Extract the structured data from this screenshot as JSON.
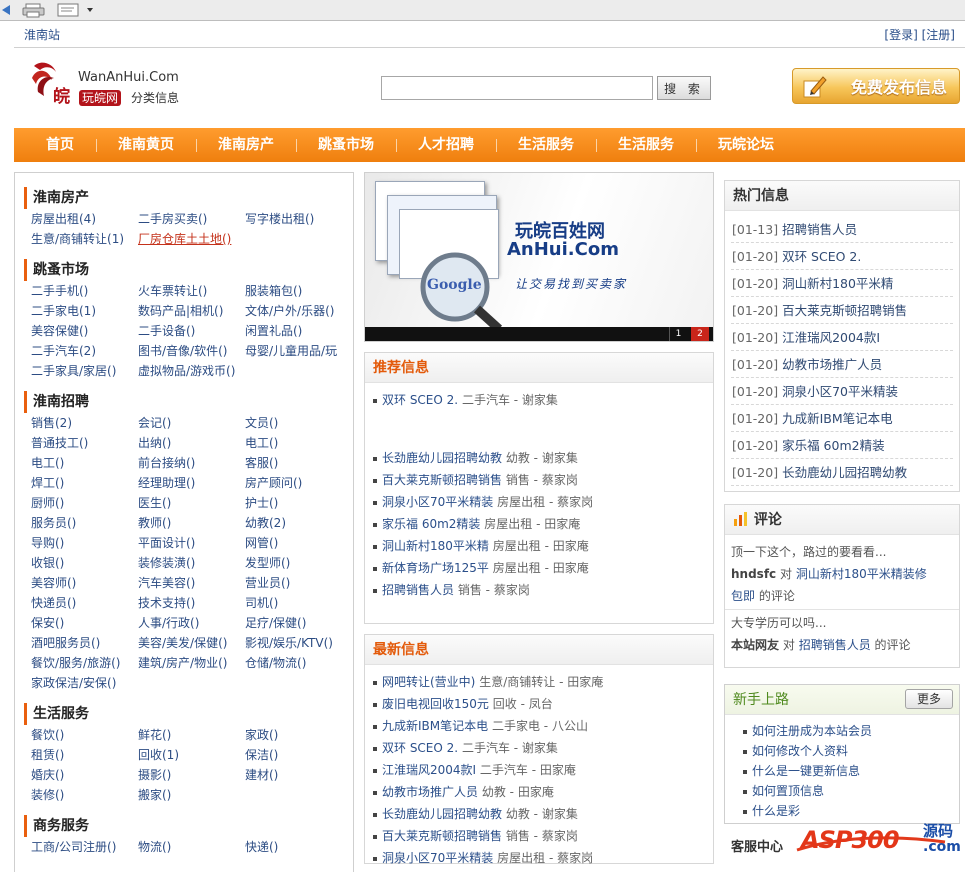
{
  "header": {
    "city": "淮南站",
    "login": "[登录]",
    "register": "[注册]",
    "logo_en": "WanAnHui.Com",
    "logo_cn_badge": "玩皖网",
    "logo_cn_text": "分类信息",
    "logo_glyph": "皖",
    "search_button": "搜 索",
    "search_value": "",
    "post_button": "免费发布信息"
  },
  "nav": [
    "首页",
    "淮南黄页",
    "淮南房产",
    "跳蚤市场",
    "人才招聘",
    "生活服务",
    "生活服务",
    "玩皖论坛"
  ],
  "categories": [
    {
      "title": "淮南房产",
      "items": [
        "房屋出租(4)",
        "二手房买卖()",
        "写字楼出租()",
        "生意/商铺转让(1)",
        "厂房仓库土土地()"
      ],
      "hot_index": 4
    },
    {
      "title": "跳蚤市场",
      "items": [
        "二手手机()",
        "火车票转让()",
        "服装箱包()",
        "二手家电(1)",
        "数码产品|相机()",
        "文体/户外/乐器()",
        "美容保健()",
        "二手设备()",
        "闲置礼品()",
        "二手汽车(2)",
        "图书/音像/软件()",
        "母婴/儿童用品/玩",
        "二手家具/家居()",
        "虚拟物品/游戏币()"
      ]
    },
    {
      "title": "淮南招聘",
      "items": [
        "销售(2)",
        "会记()",
        "文员()",
        "普通技工()",
        "出纳()",
        "电工()",
        "电工()",
        "前台接纳()",
        "客服()",
        "焊工()",
        "经理助理()",
        "房产顾问()",
        "厨师()",
        "医生()",
        "护士()",
        "服务员()",
        "教师()",
        "幼教(2)",
        "导购()",
        "平面设计()",
        "网管()",
        "收银()",
        "装修装潢()",
        "发型师()",
        "美容师()",
        "汽车美容()",
        "营业员()",
        "快递员()",
        "技术支持()",
        "司机()",
        "保安()",
        "人事/行政()",
        "足疗/保健()",
        "酒吧服务员()",
        "美容/美发/保健()",
        "影视/娱乐/KTV()",
        "餐饮/服务/旅游()",
        "建筑/房产/物业()",
        "仓储/物流()",
        "家政保洁/安保()"
      ]
    },
    {
      "title": "生活服务",
      "items": [
        "餐饮()",
        "鲜花()",
        "家政()",
        "租赁()",
        "回收(1)",
        "保洁()",
        "婚庆()",
        "摄影()",
        "建材()",
        "装修()",
        "搬家()"
      ]
    },
    {
      "title": "商务服务",
      "items": [
        "工商/公司注册()",
        "物流()",
        "快递()"
      ]
    }
  ],
  "banner": {
    "title_cn": "玩皖百姓网",
    "title_en": "AnHui.Com",
    "slogan": "让交易找到买卖家",
    "search_logo": "Google",
    "page1": "1",
    "page2": "2"
  },
  "recommend": {
    "title": "推荐信息",
    "top": [
      {
        "t": "双环 SCEO 2.",
        "c": "二手汽车",
        "p": "谢家集"
      }
    ],
    "items": [
      {
        "t": "长劲鹿幼儿园招聘幼教",
        "c": "幼教",
        "p": "谢家集"
      },
      {
        "t": "百大莱克斯顿招聘销售",
        "c": "销售",
        "p": "蔡家岗"
      },
      {
        "t": "洞泉小区70平米精装",
        "c": "房屋出租",
        "p": "蔡家岗"
      },
      {
        "t": "家乐福 60m2精装",
        "c": "房屋出租",
        "p": "田家庵"
      },
      {
        "t": "洞山新村180平米精",
        "c": "房屋出租",
        "p": "田家庵"
      },
      {
        "t": "新体育场广场125平",
        "c": "房屋出租",
        "p": "田家庵"
      },
      {
        "t": "招聘销售人员",
        "c": "销售",
        "p": "蔡家岗"
      }
    ]
  },
  "latest": {
    "title": "最新信息",
    "items": [
      {
        "t": "网吧转让(营业中)",
        "c": "生意/商铺转让",
        "p": "田家庵"
      },
      {
        "t": "废旧电视回收150元",
        "c": "回收",
        "p": "凤台"
      },
      {
        "t": "九成新IBM笔记本电",
        "c": "二手家电",
        "p": "八公山"
      },
      {
        "t": "双环 SCEO 2.",
        "c": "二手汽车",
        "p": "谢家集"
      },
      {
        "t": "江淮瑞风2004款I",
        "c": "二手汽车",
        "p": "田家庵"
      },
      {
        "t": "幼教市场推广人员",
        "c": "幼教",
        "p": "田家庵"
      },
      {
        "t": "长劲鹿幼儿园招聘幼教",
        "c": "幼教",
        "p": "谢家集"
      },
      {
        "t": "百大莱克斯顿招聘销售",
        "c": "销售",
        "p": "蔡家岗"
      },
      {
        "t": "洞泉小区70平米精装",
        "c": "房屋出租",
        "p": "蔡家岗"
      }
    ]
  },
  "hot": {
    "title": "热门信息",
    "items": [
      {
        "d": "[01-13]",
        "t": "招聘销售人员"
      },
      {
        "d": "[01-20]",
        "t": "双环 SCEO 2."
      },
      {
        "d": "[01-20]",
        "t": "洞山新村180平米精"
      },
      {
        "d": "[01-20]",
        "t": "百大莱克斯顿招聘销售"
      },
      {
        "d": "[01-20]",
        "t": "江淮瑞风2004款I"
      },
      {
        "d": "[01-20]",
        "t": "幼教市场推广人员"
      },
      {
        "d": "[01-20]",
        "t": "洞泉小区70平米精装"
      },
      {
        "d": "[01-20]",
        "t": "九成新IBM笔记本电"
      },
      {
        "d": "[01-20]",
        "t": "家乐福 60m2精装"
      },
      {
        "d": "[01-20]",
        "t": "长劲鹿幼儿园招聘幼教"
      }
    ]
  },
  "comments": {
    "title": "评论",
    "c1_text": "顶一下这个，路过的要看看...",
    "c1_user": "hndsfc",
    "c1_on": "对",
    "c1_link": "洞山新村180平米精装修",
    "c1_link2": "包即",
    "c1_suffix": "的评论",
    "c2_text": "大专学历可以吗...",
    "c2_user": "本站网友",
    "c2_on": "对",
    "c2_link": "招聘销售人员",
    "c2_suffix": "的评论"
  },
  "newbie": {
    "title": "新手上路",
    "more": "更多",
    "items": [
      "如何注册成为本站会员",
      "如何修改个人资料",
      "什么是一键更新信息",
      "如何置顶信息",
      "什么是彩"
    ]
  },
  "service": {
    "title": "客服中心"
  },
  "watermark": {
    "main": "ASP300",
    "sub": "源码",
    "dot": ".com"
  },
  "colors": {
    "accent": "#f08a1c",
    "title_orange": "#e35a0a",
    "link_blue": "#2b4f8a"
  }
}
